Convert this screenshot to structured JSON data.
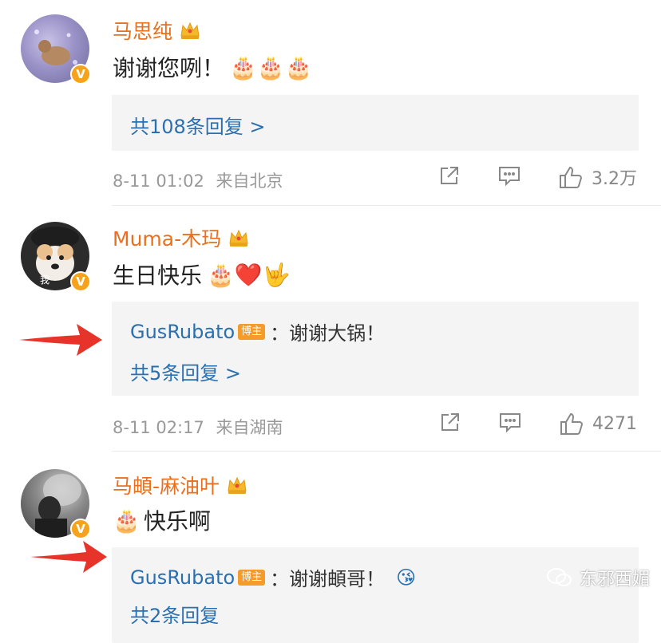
{
  "comments": [
    {
      "name": "马思纯",
      "text": "谢谢您咧！",
      "emoji": "🎂🎂🎂",
      "reply_summary": "共108条回复 >",
      "time": "8-11 01:02",
      "location": "来自北京",
      "likes": "3.2万",
      "avatar_color": "#8a8fb8"
    },
    {
      "name": "Muma-木玛",
      "text": "生日快乐",
      "emoji": "🎂❤️🤟",
      "reply_user": "GusRubato",
      "reply_tag": "博主",
      "reply_text": "：谢谢大锅！",
      "reply_summary": "共5条回复 >",
      "time": "8-11 02:17",
      "location": "来自湖南",
      "likes": "4271",
      "avatar_caption": "我",
      "avatar_color": "#2b2b2b"
    },
    {
      "name": "马頔-麻油叶",
      "text": "快乐啊",
      "emoji_prefix": "🎂",
      "reply_user": "GusRubato",
      "reply_tag": "博主",
      "reply_text": "：谢谢頔哥！",
      "reply_emoji": "😘",
      "reply_summary": "共2条回复",
      "avatar_color": "#5a5a5a"
    }
  ],
  "icons": {
    "verified": "V",
    "crown": "crown-icon",
    "share": "share-icon",
    "comment": "comment-icon",
    "like": "thumbs-up-icon"
  },
  "watermark": {
    "text": "东邪西媚"
  },
  "colors": {
    "name": "#e8701e",
    "link": "#2a6fb0",
    "meta": "#999999",
    "reply_bg": "#f4f4f4",
    "arrow": "#e8332b",
    "badge": "#f7a21b"
  }
}
